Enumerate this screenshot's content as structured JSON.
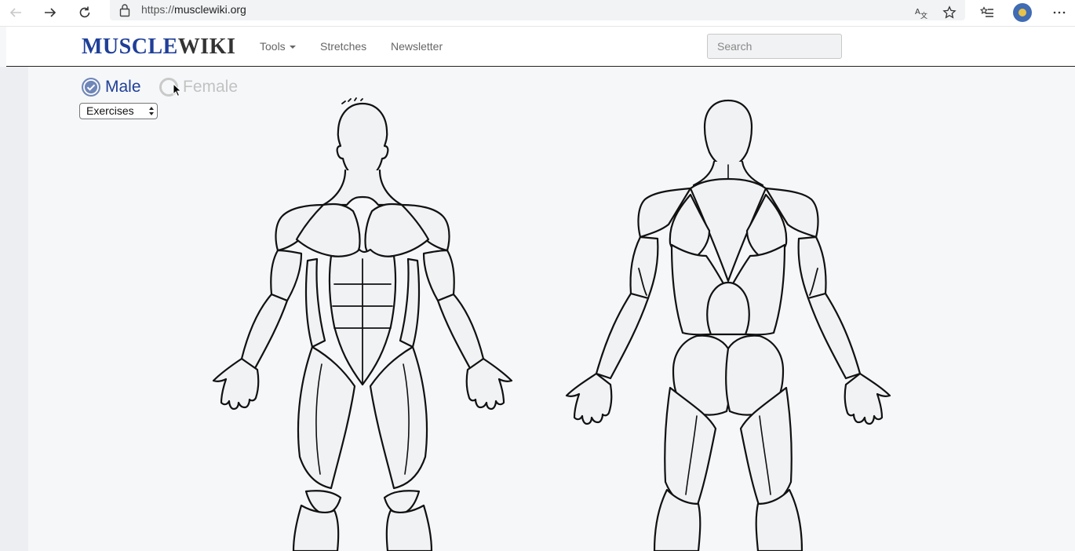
{
  "browser": {
    "url_protocol": "https://",
    "url_host": "musclewiki.org"
  },
  "site": {
    "logo_part1": "MUSCLE",
    "logo_part2": "WIKI",
    "nav": [
      {
        "label": "Tools"
      },
      {
        "label": "Stretches"
      },
      {
        "label": "Newsletter"
      }
    ],
    "search_placeholder": "Search"
  },
  "gender": {
    "male_label": "Male",
    "female_label": "Female",
    "selected": "Male"
  },
  "view_select": {
    "selected": "Exercises"
  },
  "colors": {
    "brand_blue": "#1f3f98",
    "radio_selected": "#6f86b8",
    "body_fill": "#f1f2f4",
    "outline": "#111111"
  },
  "icons": [
    "back-icon",
    "forward-icon",
    "refresh-icon",
    "lock-icon",
    "translate-icon",
    "star-icon",
    "favorites-icon",
    "profile-icon",
    "more-icon",
    "check-icon",
    "select-arrows-icon",
    "cursor-icon"
  ]
}
